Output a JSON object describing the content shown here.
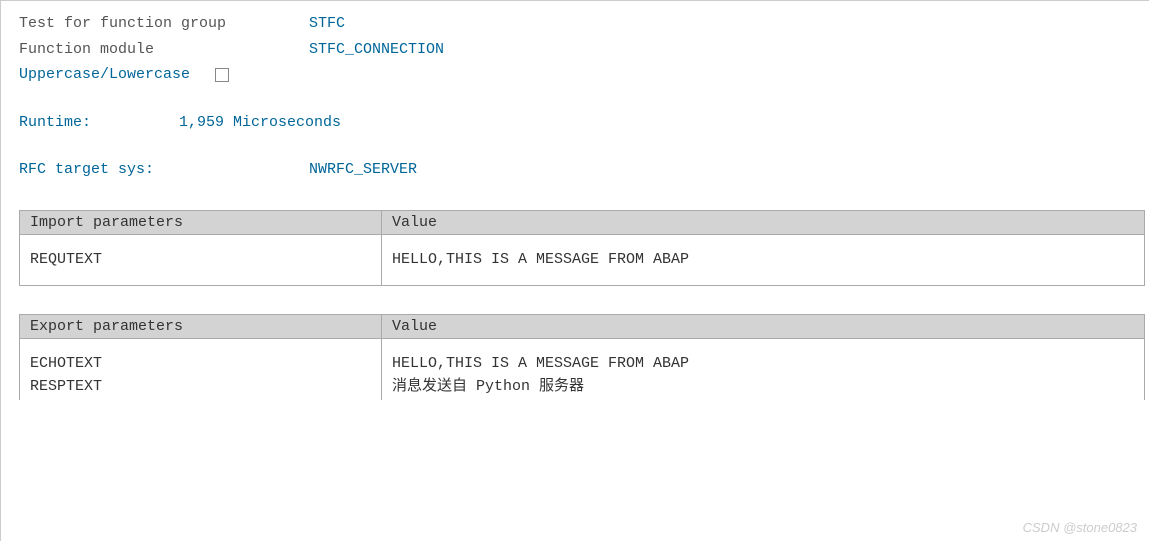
{
  "header": {
    "function_group_label": "Test for function group",
    "function_group_value": "STFC",
    "function_module_label": "Function module",
    "function_module_value": "STFC_CONNECTION",
    "uppercase_label": "Uppercase/Lowercase"
  },
  "runtime": {
    "label": "Runtime:",
    "value": "1,959 Microseconds"
  },
  "rfc": {
    "label": "RFC target sys:",
    "value": "NWRFC_SERVER"
  },
  "import_table": {
    "header_param": "Import parameters",
    "header_value": "Value",
    "rows": [
      {
        "param": "REQUTEXT",
        "value": "HELLO,THIS IS A MESSAGE FROM ABAP"
      }
    ]
  },
  "export_table": {
    "header_param": "Export parameters",
    "header_value": "Value",
    "rows": [
      {
        "param": "ECHOTEXT",
        "value": "HELLO,THIS IS A MESSAGE FROM ABAP"
      },
      {
        "param": "RESPTEXT",
        "value": "消息发送自 Python 服务器"
      }
    ]
  },
  "watermark": "CSDN @stone0823"
}
